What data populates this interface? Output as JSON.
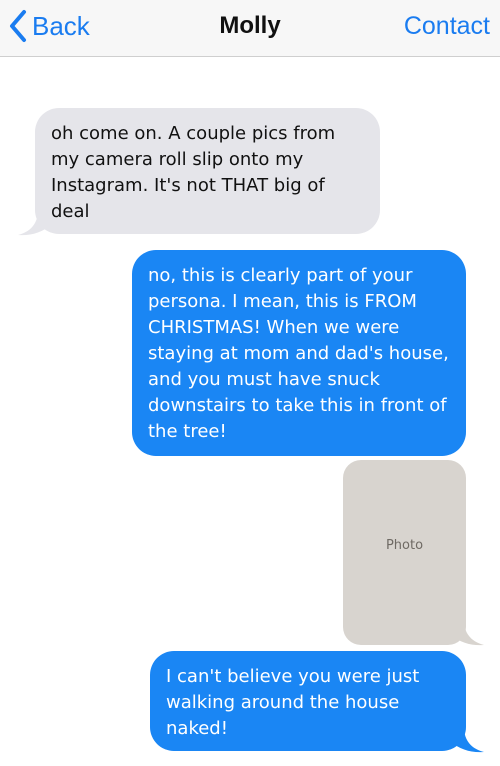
{
  "nav": {
    "back_label": "Back",
    "title": "Molly",
    "contact_label": "Contact"
  },
  "messages": [
    {
      "from": "received",
      "text": "oh come on. A couple pics from my camera roll slip onto my Instagram. It's not THAT big of deal"
    },
    {
      "from": "sent",
      "text": "no, this is clearly part of your persona. I mean, this is FROM CHRISTMAS! When we were staying at mom and dad's house, and you must have snuck downstairs to take this in front of the tree!"
    },
    {
      "from": "sent",
      "type": "photo",
      "placeholder": "Photo"
    },
    {
      "from": "sent",
      "text": "I can't believe you were just walking around the house naked!"
    }
  ],
  "colors": {
    "accent": "#1a7cf0",
    "sent_bubble": "#1a86f4",
    "received_bubble": "#e5e5ea"
  },
  "icons": {
    "back": "chevron-left-icon"
  }
}
